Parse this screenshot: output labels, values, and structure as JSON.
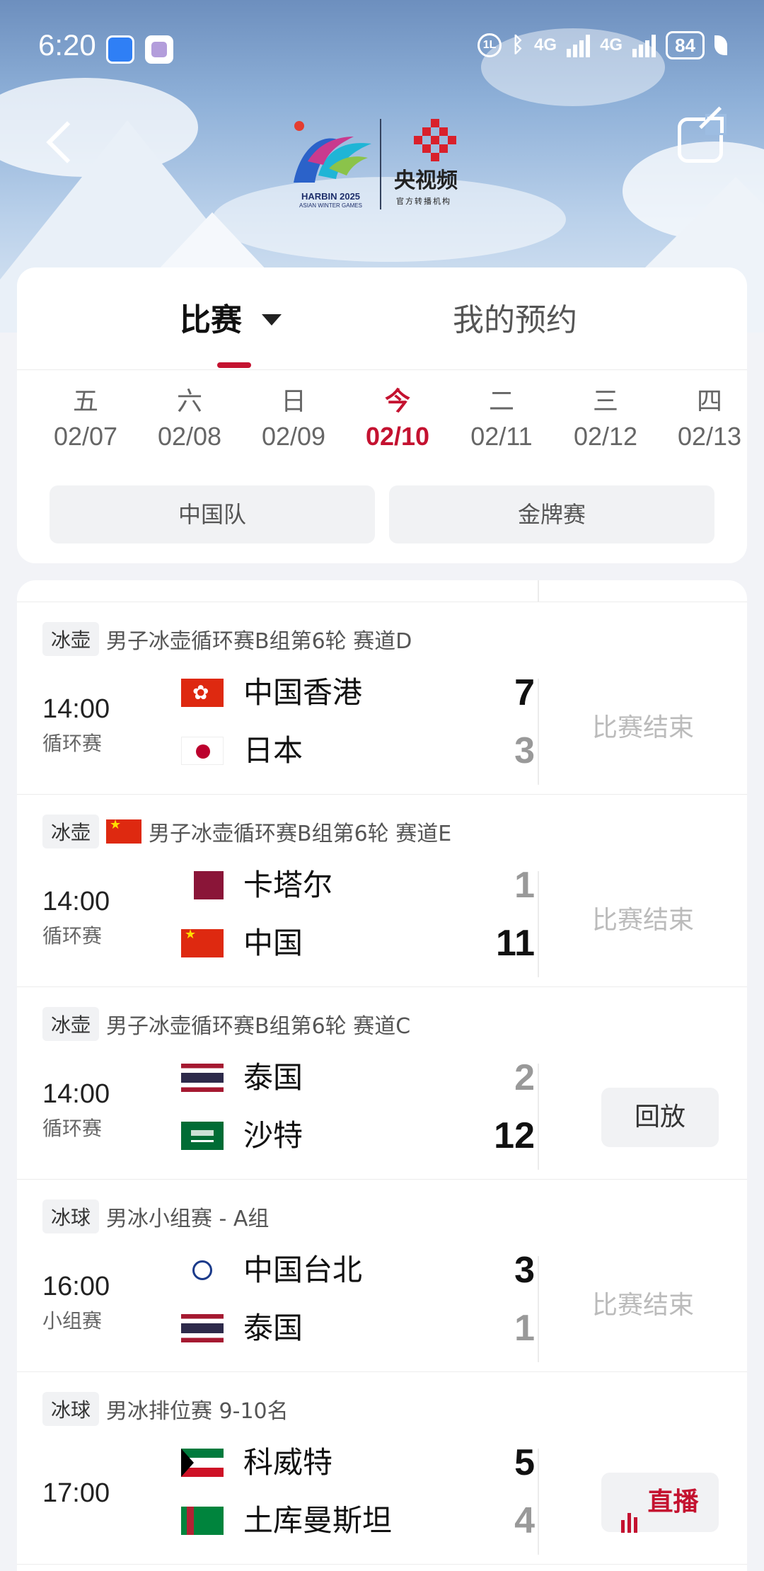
{
  "status_bar": {
    "time": "6:20",
    "battery": "84",
    "network_1": "4G",
    "network_2": "4G"
  },
  "header": {
    "logo_left_title": "HARBIN 2025",
    "logo_left_sub": "ASIAN WINTER GAMES",
    "logo_right_title": "央视频",
    "logo_right_sub": "官方转播机构"
  },
  "tabs": [
    {
      "label": "比赛",
      "active": true
    },
    {
      "label": "我的预约",
      "active": false
    }
  ],
  "dates": [
    {
      "day": "五",
      "date": "02/07"
    },
    {
      "day": "六",
      "date": "02/08"
    },
    {
      "day": "日",
      "date": "02/09"
    },
    {
      "day": "今",
      "date": "02/10",
      "today": true
    },
    {
      "day": "二",
      "date": "02/11"
    },
    {
      "day": "三",
      "date": "02/12"
    },
    {
      "day": "四",
      "date": "02/13"
    }
  ],
  "filters": [
    "中国队",
    "金牌赛"
  ],
  "matches": [
    {
      "sport": "冰壶",
      "event": "男子冰壶循环赛B组第6轮 赛道D",
      "time": "14:00",
      "stage": "循环赛",
      "team1": {
        "name": "中国香港",
        "score": "7",
        "flag": "hk-flag-icon"
      },
      "team2": {
        "name": "日本",
        "score": "3",
        "flag": "japan-flag-icon"
      },
      "status": "比赛结束"
    },
    {
      "sport": "冰壶",
      "event": "男子冰壶循环赛B组第6轮 赛道E",
      "time": "14:00",
      "stage": "循环赛",
      "team1": {
        "name": "卡塔尔",
        "score": "1",
        "flag": "qatar-flag-icon"
      },
      "team2": {
        "name": "中国",
        "score": "11",
        "flag": "china-flag-icon"
      },
      "status": "比赛结束"
    },
    {
      "sport": "冰壶",
      "event": "男子冰壶循环赛B组第6轮 赛道C",
      "time": "14:00",
      "stage": "循环赛",
      "team1": {
        "name": "泰国",
        "score": "2",
        "flag": "thailand-flag-icon"
      },
      "team2": {
        "name": "沙特",
        "score": "12",
        "flag": "saudi-flag-icon"
      },
      "status": "回放"
    },
    {
      "sport": "冰球",
      "event": "男冰小组赛 - A组",
      "time": "16:00",
      "stage": "小组赛",
      "team1": {
        "name": "中国台北",
        "score": "3",
        "flag": "chinese-taipei-flag-icon"
      },
      "team2": {
        "name": "泰国",
        "score": "1",
        "flag": "thailand-flag-icon"
      },
      "status": "比赛结束"
    },
    {
      "sport": "冰球",
      "event": "男冰排位赛 9-10名",
      "time": "17:00",
      "stage": "",
      "team1": {
        "name": "科威特",
        "score": "5",
        "flag": "kuwait-flag-icon"
      },
      "team2": {
        "name": "土库曼斯坦",
        "score": "4",
        "flag": "turkmenistan-flag-icon"
      },
      "status": "直播"
    }
  ],
  "colors": {
    "accent": "#c41230",
    "muted": "#bbbbbb",
    "chip_bg": "#f1f2f4"
  }
}
